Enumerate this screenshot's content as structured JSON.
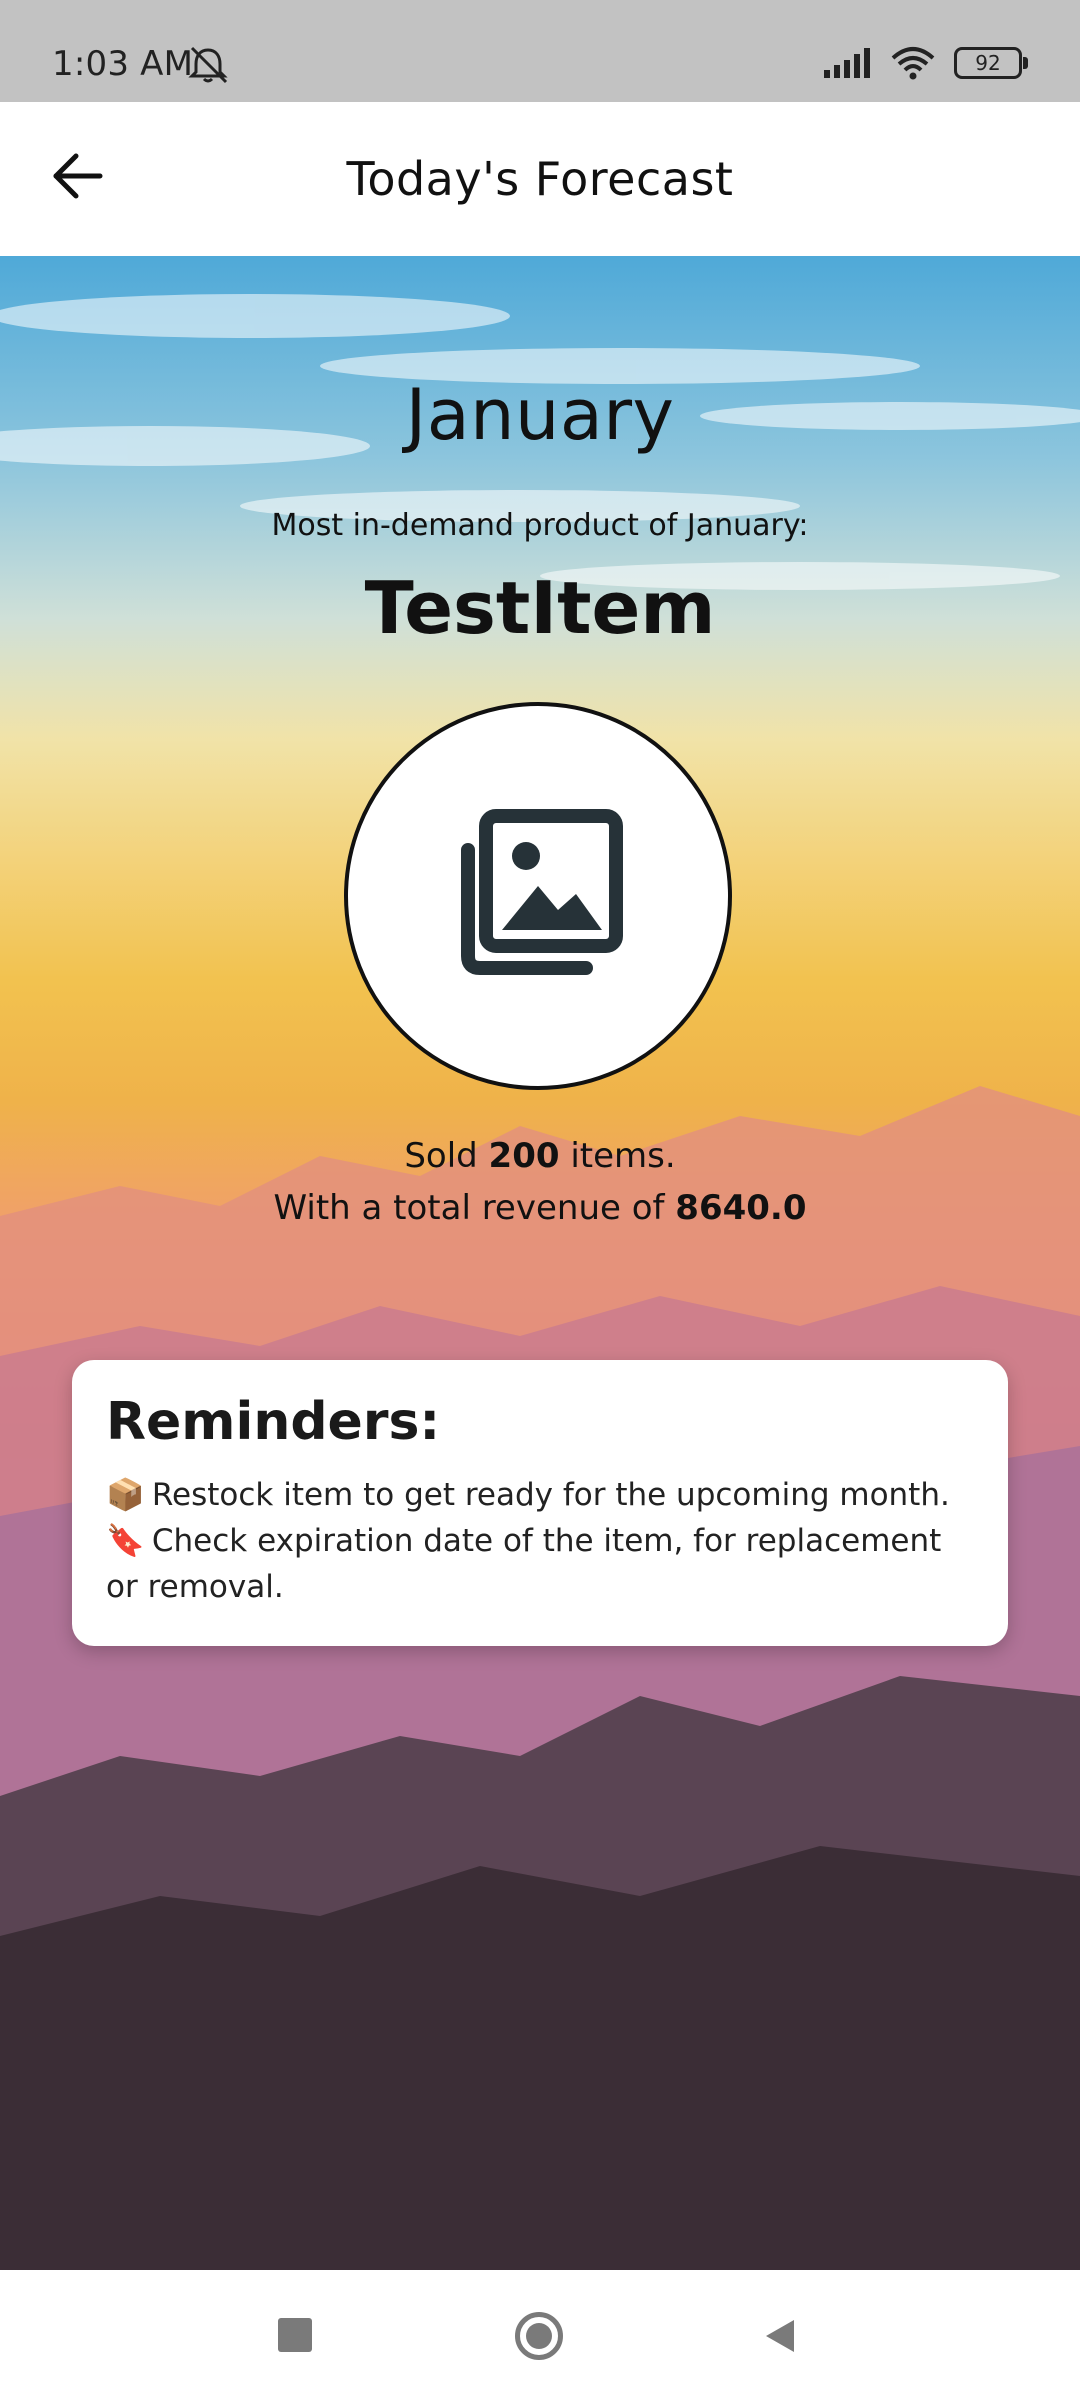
{
  "status_bar": {
    "time": "1:03 AM",
    "battery": "92",
    "icons": [
      "alarm-off-icon",
      "signal-icon",
      "wifi-icon",
      "battery-icon"
    ]
  },
  "header": {
    "title": "Today's Forecast",
    "back_icon": "arrow-left-icon"
  },
  "forecast": {
    "month": "January",
    "demand_label": "Most in-demand product of January:",
    "product_name": "TestItem",
    "image_icon": "image-placeholder-icon",
    "sold_prefix": "Sold ",
    "sold_count": "200",
    "sold_suffix": " items.",
    "revenue_prefix": "With a total revenue of ",
    "revenue_value": "8640.0"
  },
  "reminders": {
    "title": "Reminders:",
    "items": [
      {
        "emoji": "📦",
        "text": "Restock item to get ready for the upcoming month."
      },
      {
        "emoji": "🔖",
        "text": "Check expiration date of the item, for replacement or removal."
      }
    ]
  },
  "nav_bar": {
    "icons": [
      "recents-square-icon",
      "home-circle-icon",
      "back-triangle-icon"
    ]
  }
}
